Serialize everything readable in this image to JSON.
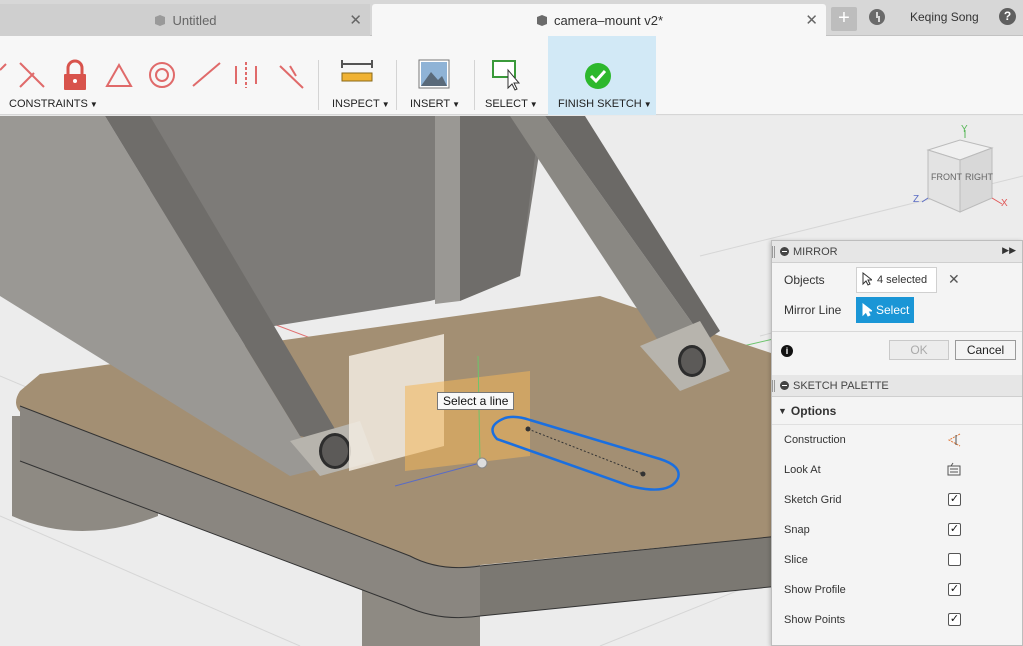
{
  "tabs": [
    {
      "label": "Untitled",
      "active": false
    },
    {
      "label": "camera–mount v2*",
      "active": true
    }
  ],
  "tabbar": {
    "user": "Keqing Song",
    "new_tab": "+",
    "help": "?"
  },
  "toolbar": {
    "constraints_label": "CONSTRAINTS",
    "inspect_label": "INSPECT",
    "insert_label": "INSERT",
    "select_label": "SELECT",
    "finish_label": "FINISH SKETCH",
    "accent": "#d2e9f6",
    "constraint_color": "#e06a6a"
  },
  "viewport": {
    "tooltip": "Select a line",
    "viewcube": {
      "front": "FRONT",
      "right": "RIGHT",
      "axis_x": "X",
      "axis_y": "Y",
      "axis_z": "Z"
    }
  },
  "mirror": {
    "title": "MIRROR",
    "objects_label": "Objects",
    "objects_value": "4 selected",
    "mirror_line_label": "Mirror Line",
    "mirror_line_button": "Select",
    "ok": "OK",
    "cancel": "Cancel"
  },
  "palette": {
    "title": "SKETCH PALETTE",
    "options_label": "Options",
    "options": [
      {
        "label": "Construction",
        "type": "icon"
      },
      {
        "label": "Look At",
        "type": "icon"
      },
      {
        "label": "Sketch Grid",
        "type": "check",
        "checked": true
      },
      {
        "label": "Snap",
        "type": "check",
        "checked": true
      },
      {
        "label": "Slice",
        "type": "check",
        "checked": false
      },
      {
        "label": "Show Profile",
        "type": "check",
        "checked": true
      },
      {
        "label": "Show Points",
        "type": "check",
        "checked": true
      }
    ]
  }
}
